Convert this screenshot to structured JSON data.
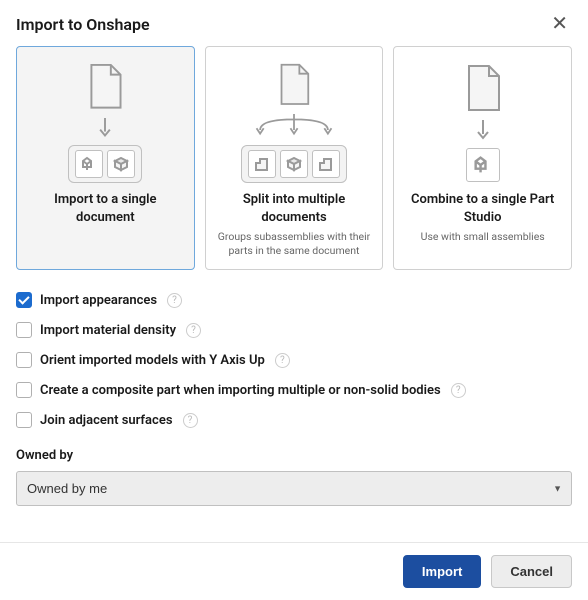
{
  "header": {
    "title": "Import to Onshape"
  },
  "modes": [
    {
      "title": "Import to a single document",
      "subtitle": ""
    },
    {
      "title": "Split into multiple documents",
      "subtitle": "Groups subassemblies with their parts in the same document"
    },
    {
      "title": "Combine to a single Part Studio",
      "subtitle": "Use with small assemblies"
    }
  ],
  "checks": {
    "appearances": "Import appearances",
    "density": "Import material density",
    "yaxis": "Orient imported models with Y Axis Up",
    "composite": "Create a composite part when importing multiple or non-solid bodies",
    "join": "Join adjacent surfaces"
  },
  "owned": {
    "label": "Owned by",
    "value": "Owned by me"
  },
  "footer": {
    "import": "Import",
    "cancel": "Cancel"
  }
}
